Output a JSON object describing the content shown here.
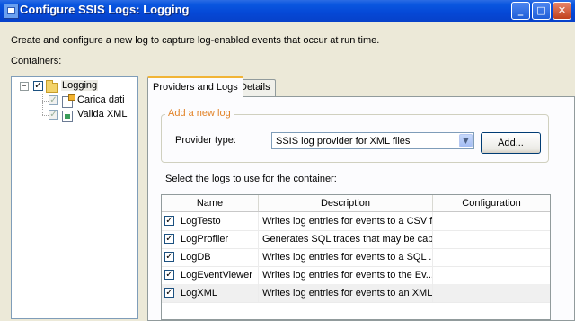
{
  "window": {
    "title": "Configure SSIS Logs: Logging",
    "minimize_glyph": "_",
    "maximize_glyph": "□",
    "close_glyph": "✕"
  },
  "description": "Create and configure a new log to capture log-enabled events that occur at run time.",
  "containers_label": "Containers:",
  "tree": {
    "root": {
      "label": "Logging",
      "checked": true,
      "expanded": true,
      "icon": "folder-icon"
    },
    "children": [
      {
        "label": "Carica dati",
        "checked": true,
        "icon": "data-flow-task-icon"
      },
      {
        "label": "Valida XML",
        "checked": true,
        "icon": "script-task-icon"
      }
    ],
    "expander_glyph": "−",
    "check_glyph": "✓"
  },
  "tabs": [
    {
      "label": "Providers and Logs",
      "active": true
    },
    {
      "label": "Details",
      "active": false
    }
  ],
  "add_new_log": {
    "group_title": "Add a new log",
    "provider_label": "Provider type:",
    "provider_value": "SSIS log provider for XML files",
    "dropdown_glyph": "▼",
    "add_button": "Add..."
  },
  "logs": {
    "instruction": "Select the logs to use for the container:",
    "columns": [
      "Name",
      "Description",
      "Configuration"
    ],
    "rows": [
      {
        "checked": true,
        "name": "LogTesto",
        "description": "Writes log entries for events to a CSV file",
        "configuration": ""
      },
      {
        "checked": true,
        "name": "LogProfiler",
        "description": "Generates SQL traces that may be cap...",
        "configuration": ""
      },
      {
        "checked": true,
        "name": "LogDB",
        "description": "Writes log entries for events to a SQL ...",
        "configuration": ""
      },
      {
        "checked": true,
        "name": "LogEventViewer",
        "description": "Writes log entries for events to the Ev...",
        "configuration": ""
      },
      {
        "checked": true,
        "name": "LogXML",
        "description": "Writes log entries for events to an XML...",
        "configuration": ""
      }
    ],
    "check_glyph": "✓"
  }
}
